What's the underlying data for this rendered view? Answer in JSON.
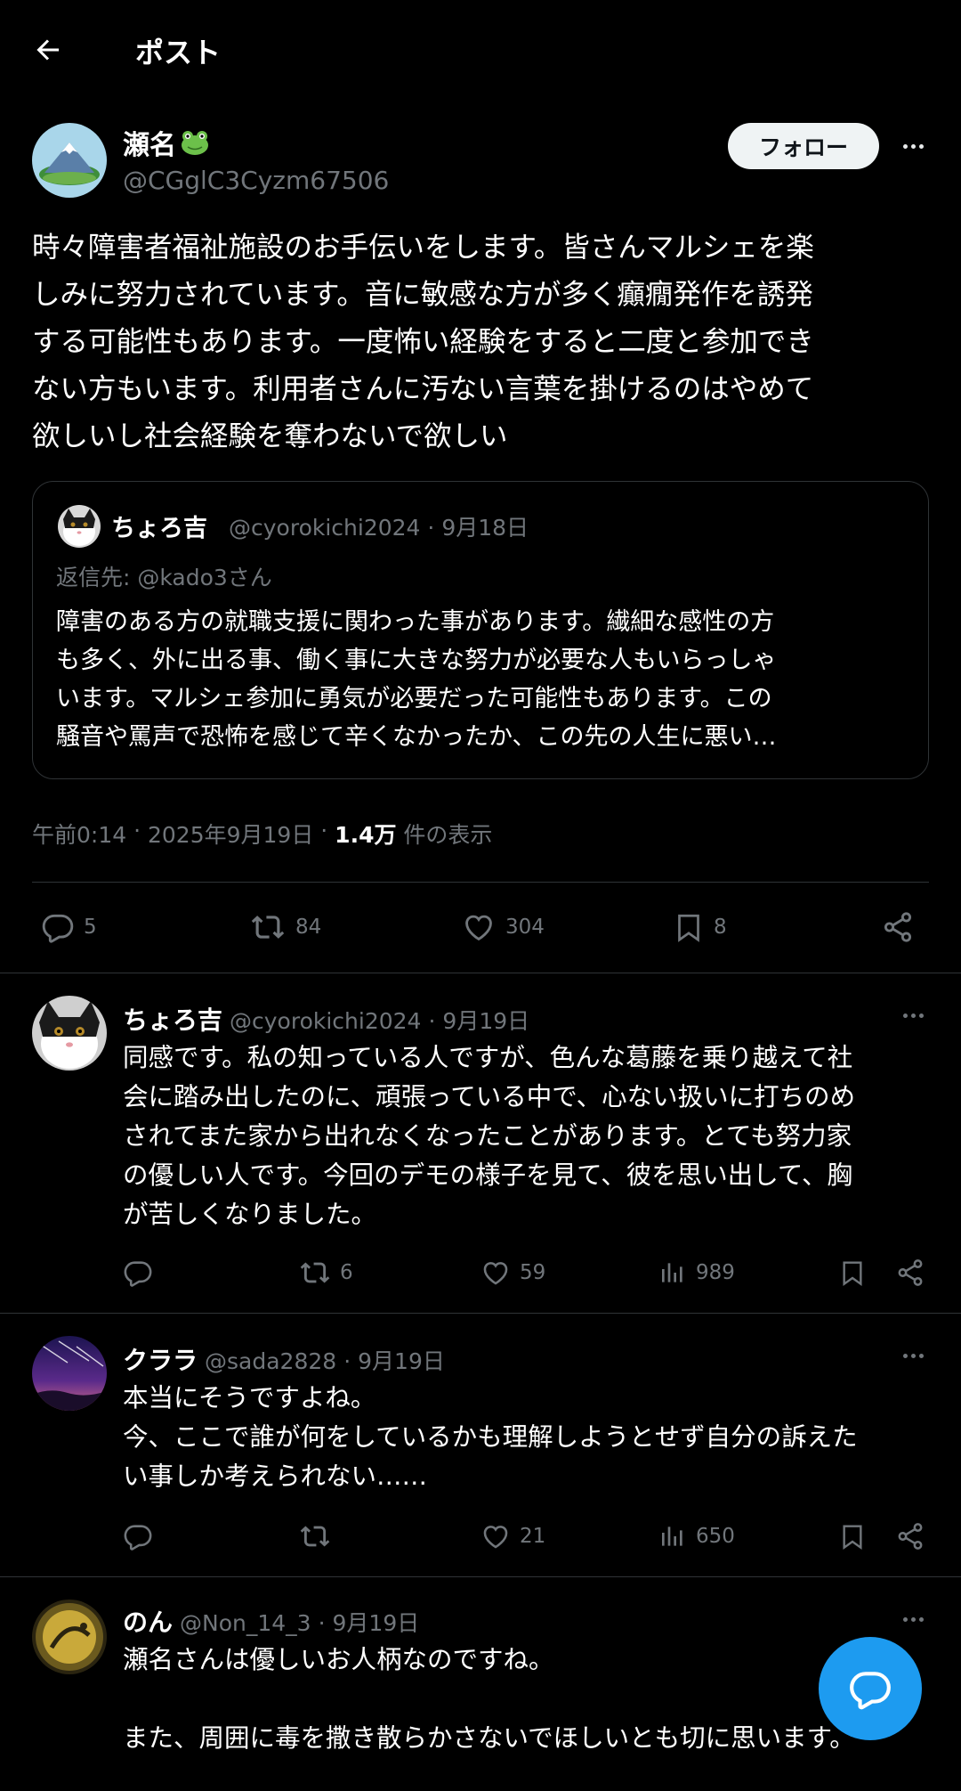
{
  "header": {
    "title": "ポスト"
  },
  "post": {
    "name": "瀬名",
    "handle": "@CGglC3Cyzm67506",
    "follow_label": "フォロー",
    "text": "時々障害者福祉施設のお手伝いをします。皆さんマルシェを楽\nしみに努力されています。音に敏感な方が多く癲癇発作を誘発\nする可能性もあります。一度怖い経験をすると二度と参加でき\nない方もいます。利用者さんに汚ない言葉を掛けるのはやめて\n欲しいし社会経験を奪わないで欲しい",
    "quote": {
      "name": "ちょろ吉",
      "handle": "@cyorokichi2024",
      "date": "9月18日",
      "reply_to": "返信先: @kado3さん",
      "text": "障害のある方の就職支援に関わった事があります。繊細な感性の方\nも多く、外に出る事、働く事に大きな努力が必要な人もいらっしゃ\nいます。マルシェ参加に勇気が必要だった可能性もあります。この\n騒音や罵声で恐怖を感じて辛くなかったか、この先の人生に悪い…"
    },
    "time": "午前0:14",
    "date": "2025年9月19日",
    "views_count": "1.4万",
    "views_label": "件の表示",
    "stats": {
      "replies": "5",
      "reposts": "84",
      "likes": "304",
      "bookmarks": "8"
    }
  },
  "replies": [
    {
      "name": "ちょろ吉",
      "handle": "@cyorokichi2024",
      "date": "9月19日",
      "text": "同感です。私の知っている人ですが、色んな葛藤を乗り越えて社\n会に踏み出したのに、頑張っている中で、心ない扱いに打ちのめ\nされてまた家から出れなくなったことがあります。とても努力家\nの優しい人です。今回のデモの様子を見て、彼を思い出して、胸\nが苦しくなりました。",
      "replies": "",
      "reposts": "6",
      "likes": "59",
      "views": "989"
    },
    {
      "name": "クララ",
      "handle": "@sada2828",
      "date": "9月19日",
      "text": "本当にそうですよね。\n今、ここで誰が何をしているかも理解しようとせず自分の訴えた\nい事しか考えられない……",
      "replies": "",
      "reposts": "",
      "likes": "21",
      "views": "650"
    },
    {
      "name": "のん",
      "handle": "@Non_14_3",
      "date": "9月19日",
      "text": "瀬名さんは優しいお人柄なのですね。\n\nまた、周囲に毒を撒き散らかさないでほしいとも切に思います。"
    }
  ],
  "colors": {
    "accent": "#1d9bf0",
    "muted": "#71767b",
    "divider": "#2f3336",
    "background": "#000000"
  },
  "icons": [
    "back-arrow-icon",
    "more-icon",
    "reply-icon",
    "repost-icon",
    "like-icon",
    "bookmark-icon",
    "share-icon",
    "views-icon",
    "compose-reply-icon"
  ]
}
